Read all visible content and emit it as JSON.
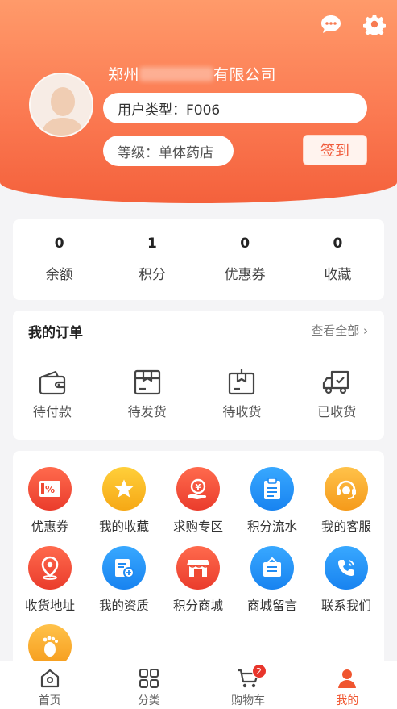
{
  "header": {
    "company_prefix": "郑州",
    "company_suffix": "有限公司",
    "user_type": "用户类型：F006",
    "level": "等级：单体药店",
    "signin_label": "签到",
    "icons": [
      "chat-icon",
      "settings-icon"
    ]
  },
  "stats": [
    {
      "value": "0",
      "label": "余额"
    },
    {
      "value": "1",
      "label": "积分"
    },
    {
      "value": "0",
      "label": "优惠券"
    },
    {
      "value": "0",
      "label": "收藏"
    }
  ],
  "orders": {
    "title": "我的订单",
    "view_all": "查看全部",
    "items": [
      {
        "label": "待付款",
        "icon": "wallet-icon"
      },
      {
        "label": "待发货",
        "icon": "box-icon"
      },
      {
        "label": "待收货",
        "icon": "package-receive-icon"
      },
      {
        "label": "已收货",
        "icon": "truck-icon"
      }
    ]
  },
  "services": [
    {
      "label": "优惠券",
      "icon": "coupon-icon",
      "color": "#ef4a33"
    },
    {
      "label": "我的收藏",
      "icon": "star-icon",
      "color": "#f8b51f"
    },
    {
      "label": "求购专区",
      "icon": "purchase-icon",
      "color": "#ef4a33"
    },
    {
      "label": "积分流水",
      "icon": "clipboard-icon",
      "color": "#2a95f7"
    },
    {
      "label": "我的客服",
      "icon": "headset-icon",
      "color": "#f8b51f"
    },
    {
      "label": "收货地址",
      "icon": "location-icon",
      "color": "#ef4a33"
    },
    {
      "label": "我的资质",
      "icon": "certificate-icon",
      "color": "#2a95f7"
    },
    {
      "label": "积分商城",
      "icon": "store-icon",
      "color": "#ef4a33"
    },
    {
      "label": "商城留言",
      "icon": "message-board-icon",
      "color": "#2a95f7"
    },
    {
      "label": "联系我们",
      "icon": "phone-icon",
      "color": "#2a95f7"
    },
    {
      "label": "",
      "icon": "footprint-icon",
      "color": "#f8b51f"
    }
  ],
  "tabbar": [
    {
      "label": "首页",
      "icon": "home-icon",
      "active": false
    },
    {
      "label": "分类",
      "icon": "category-icon",
      "active": false
    },
    {
      "label": "购物车",
      "icon": "cart-icon",
      "active": false,
      "badge": "2"
    },
    {
      "label": "我的",
      "icon": "profile-icon",
      "active": true
    }
  ],
  "colors": {
    "accent": "#f4613c",
    "blue": "#2a95f7",
    "yellow": "#f8b51f"
  }
}
